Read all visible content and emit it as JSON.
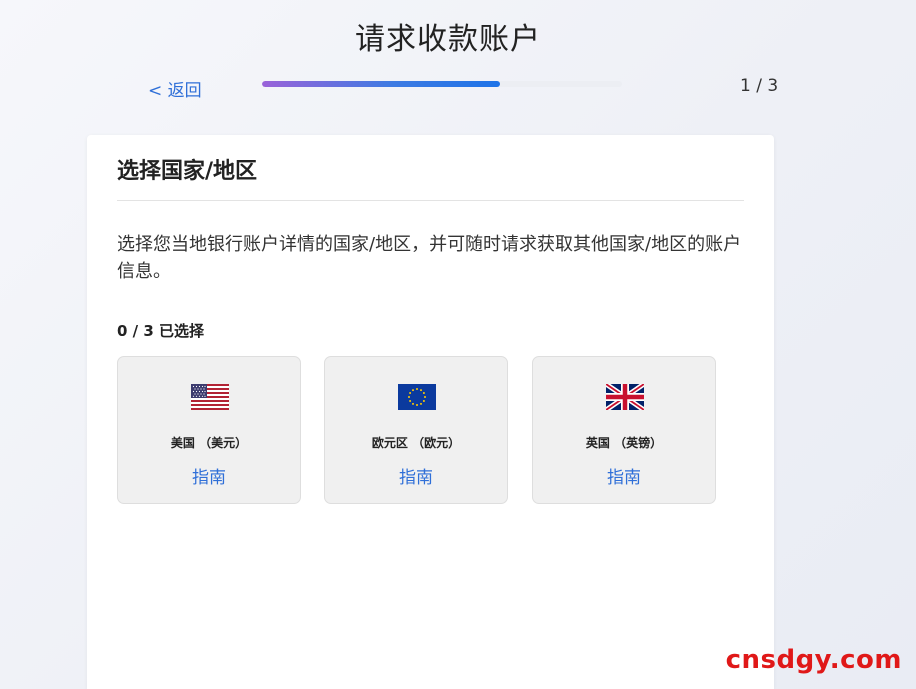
{
  "header": {
    "title": "请求收款账户",
    "back_label": "< 返回",
    "step_counter": "1 / 3",
    "progress_fraction": 0.66
  },
  "card": {
    "title": "选择国家/地区",
    "description": "选择您当地银行账户详情的国家/地区，并可随时请求获取其他国家/地区的账户信息。",
    "selected_count": "0 / 3 已选择",
    "countries": [
      {
        "name": "美国 （美元）",
        "guide_label": "指南",
        "flag_icon": "us-flag-icon"
      },
      {
        "name": "欧元区 （欧元）",
        "guide_label": "指南",
        "flag_icon": "eu-flag-icon"
      },
      {
        "name": "英国 （英镑）",
        "guide_label": "指南",
        "flag_icon": "uk-flag-icon"
      }
    ]
  },
  "watermark": "cnsdgy.com",
  "colors": {
    "link": "#2f6fd8",
    "progress_start": "#9a62d9",
    "progress_end": "#1e73e8",
    "watermark": "#e01818"
  }
}
